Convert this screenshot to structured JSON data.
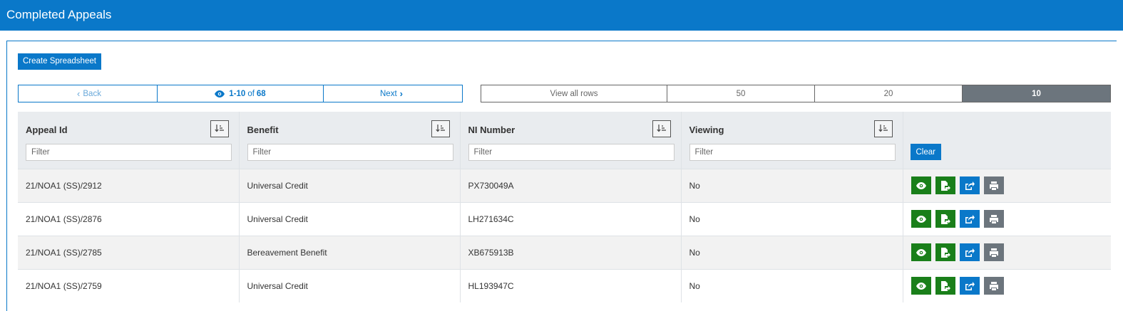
{
  "header": {
    "title": "Completed Appeals"
  },
  "toolbar": {
    "create_label": "Create Spreadsheet"
  },
  "pager": {
    "back_label": "Back",
    "range": "1-10",
    "of": "of",
    "total": "68",
    "next_label": "Next"
  },
  "rows_selector": {
    "options": [
      "View all rows",
      "50",
      "20",
      "10"
    ],
    "selected": "10"
  },
  "table": {
    "columns": [
      "Appeal Id",
      "Benefit",
      "NI Number",
      "Viewing"
    ],
    "filter_placeholder": "Filter",
    "clear_label": "Clear",
    "rows": [
      [
        "21/NOA1 (SS)/2912",
        "Universal Credit",
        "PX730049A",
        "No"
      ],
      [
        "21/NOA1 (SS)/2876",
        "Universal Credit",
        "LH271634C",
        "No"
      ],
      [
        "21/NOA1 (SS)/2785",
        "Bereavement Benefit",
        "XB675913B",
        "No"
      ],
      [
        "21/NOA1 (SS)/2759",
        "Universal Credit",
        "HL193947C",
        "No"
      ]
    ],
    "row_actions": [
      "view-icon",
      "export-file-icon",
      "share-icon",
      "print-icon"
    ]
  },
  "colors": {
    "brand": "#0a78c9",
    "green": "#1a7f1a",
    "grey": "#6c757d"
  }
}
